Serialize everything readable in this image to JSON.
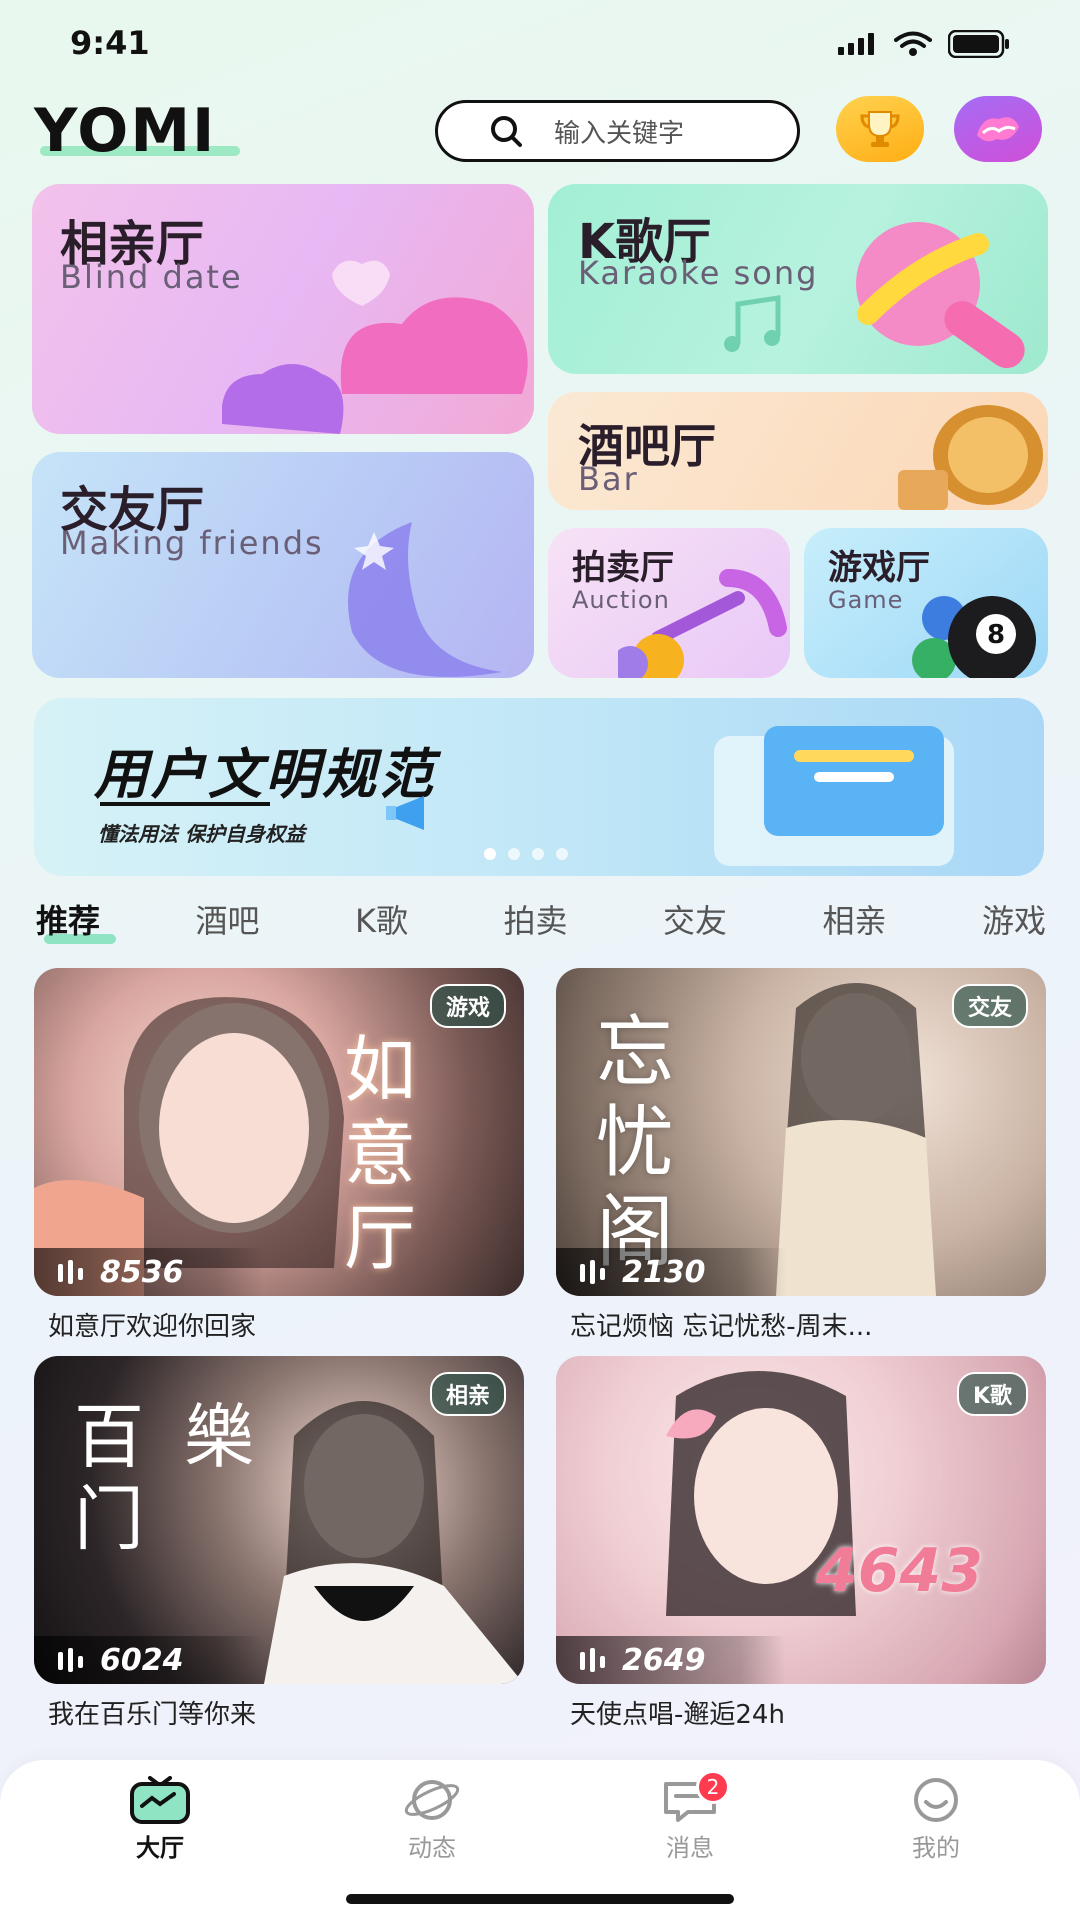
{
  "status_bar": {
    "time": "9:41"
  },
  "header": {
    "logo": "YOMI",
    "search_placeholder": "输入关键字"
  },
  "categories": [
    {
      "id": "blind",
      "title": "相亲厅",
      "subtitle": "Blind date"
    },
    {
      "id": "ktv",
      "title": "K歌厅",
      "subtitle": "Karaoke song"
    },
    {
      "id": "friends",
      "title": "交友厅",
      "subtitle": "Making friends"
    },
    {
      "id": "bar",
      "title": "酒吧厅",
      "subtitle": "Bar"
    },
    {
      "id": "auction",
      "title": "拍卖厅",
      "subtitle": "Auction"
    },
    {
      "id": "game",
      "title": "游戏厅",
      "subtitle": "Game"
    }
  ],
  "banner": {
    "title": "用户文明规范",
    "subtitle": "懂法用法 保护自身权益"
  },
  "tabs": [
    "推荐",
    "酒吧",
    "K歌",
    "拍卖",
    "交友",
    "相亲",
    "游戏"
  ],
  "rooms": [
    {
      "badge": "游戏",
      "count": "8536",
      "title": "如意厅欢迎你回家",
      "poster_text": "如意厅"
    },
    {
      "badge": "交友",
      "count": "2130",
      "title": "忘记烦恼 忘记忧愁-周末...",
      "poster_text": "忘忧阁"
    },
    {
      "badge": "相亲",
      "count": "6024",
      "title": "我在百乐门等你来",
      "poster_text": "百樂门"
    },
    {
      "badge": "K歌",
      "count": "2649",
      "title": "天使点唱-邂逅24h",
      "poster_text": "4643"
    }
  ],
  "bottom_nav": [
    {
      "label": "大厅",
      "icon": "tv-icon",
      "active": true
    },
    {
      "label": "动态",
      "icon": "planet-icon",
      "active": false
    },
    {
      "label": "消息",
      "icon": "chat-icon",
      "active": false,
      "badge": "2"
    },
    {
      "label": "我的",
      "icon": "smile-icon",
      "active": false
    }
  ],
  "colors": {
    "accent_green": "#8fe4c4",
    "badge_red": "#ff3b4f",
    "trophy": "#ffb51c",
    "avatar": "#b65de5"
  }
}
